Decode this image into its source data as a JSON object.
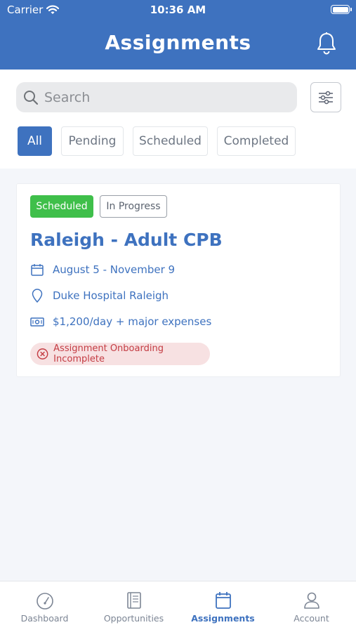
{
  "status_bar": {
    "carrier": "Carrier",
    "time": "10:36 AM"
  },
  "header": {
    "title": "Assignments",
    "bell_icon": "bell-icon"
  },
  "search": {
    "placeholder": "Search",
    "value": "",
    "icon": "search-icon"
  },
  "filter_button": {
    "icon": "sliders-icon"
  },
  "tabs": [
    {
      "label": "All",
      "active": true
    },
    {
      "label": "Pending",
      "active": false
    },
    {
      "label": "Scheduled",
      "active": false
    },
    {
      "label": "Completed",
      "active": false
    }
  ],
  "assignment": {
    "badges": [
      "Scheduled",
      "In Progress"
    ],
    "title": "Raleigh - Adult CPB",
    "dates": "August 5 - November 9",
    "location": "Duke Hospital Raleigh",
    "pay": "$1,200/day + major expenses",
    "warning": "Assignment Onboarding Incomplete"
  },
  "tab_bar": [
    {
      "label": "Dashboard",
      "icon": "gauge-icon",
      "active": false
    },
    {
      "label": "Opportunities",
      "icon": "book-icon",
      "active": false
    },
    {
      "label": "Assignments",
      "icon": "calendar-icon",
      "active": true
    },
    {
      "label": "Account",
      "icon": "user-icon",
      "active": false
    }
  ],
  "colors": {
    "primary": "#3e72bf",
    "success": "#3fbf4a",
    "danger": "#c43c43",
    "danger_bg": "#f7e1e2"
  }
}
